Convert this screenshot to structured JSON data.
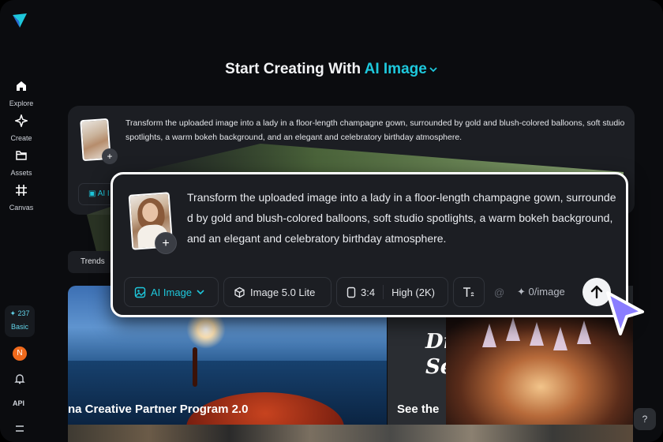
{
  "sidebar": {
    "items": [
      {
        "label": "Explore",
        "icon": "home-icon"
      },
      {
        "label": "Create",
        "icon": "sparkle-icon"
      },
      {
        "label": "Assets",
        "icon": "folder-icon"
      },
      {
        "label": "Canvas",
        "icon": "canvas-icon"
      }
    ],
    "credits": {
      "amount": "237",
      "plan": "Basic"
    },
    "avatar_initial": "N",
    "api_label": "API"
  },
  "header": {
    "title_prefix": "Start Creating With ",
    "title_accent": "AI Image"
  },
  "prompt_card": {
    "text": "Transform the uploaded image into a lady in a floor-length champagne gown, surrounded by gold and blush-colored balloons, soft studio spotlights, a warm bokeh background, and an elegant and celebratory birthday atmosphere.",
    "bg_chip_label": "AI I",
    "plus": "+"
  },
  "toolbar": {
    "mode_label": "AI Image",
    "model_label": "Image 5.0 Lite",
    "ratio_label": "3:4",
    "quality_label": "High (2K)",
    "at_symbol": "@",
    "cost_label": "0/image"
  },
  "content": {
    "trends_label": "Trends",
    "banner1_caption": "na Creative Partner Program 2.0",
    "banner2_title_line1": "Dr",
    "banner2_title_line2": "Se",
    "banner2_caption": "See the"
  },
  "help_label": "?",
  "colors": {
    "accent": "#1ec8dc",
    "background": "#0b0c0f",
    "card": "#1c1e23",
    "cursor": "#8a7dff"
  }
}
